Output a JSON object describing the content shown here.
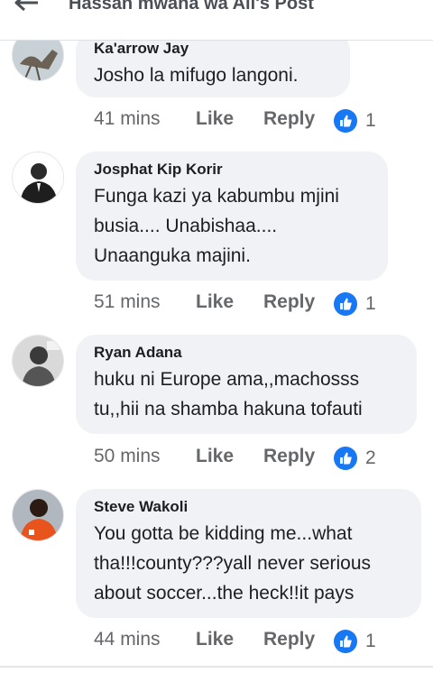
{
  "header": {
    "title": "Hassan mwana wa Ali's Post",
    "back_icon": "arrow-left-icon"
  },
  "colors": {
    "bubble": "#f0f2f5",
    "accent": "#1877f2",
    "meta": "#65676b"
  },
  "comments": [
    {
      "author": "Ka'arrow Jay",
      "text": "Josho la mifugo langoni.",
      "time": "41 mins",
      "like_label": "Like",
      "reply_label": "Reply",
      "reactions": "1"
    },
    {
      "author": "Josphat Kip Korir",
      "text": "Funga kazi ya kabumbu mjini busia.... Unabishaa.... Unaanguka majini.",
      "time": "51 mins",
      "like_label": "Like",
      "reply_label": "Reply",
      "reactions": "1"
    },
    {
      "author": "Ryan Adana",
      "text": "huku ni Europe ama,,machosss tu,,hii na shamba hakuna tofauti",
      "time": "50 mins",
      "like_label": "Like",
      "reply_label": "Reply",
      "reactions": "2"
    },
    {
      "author": "Steve Wakoli",
      "text": "You gotta be kidding me...what tha!!!county???yall never serious about soccer...the heck!!it pays",
      "time": "44 mins",
      "like_label": "Like",
      "reply_label": "Reply",
      "reactions": "1"
    }
  ]
}
